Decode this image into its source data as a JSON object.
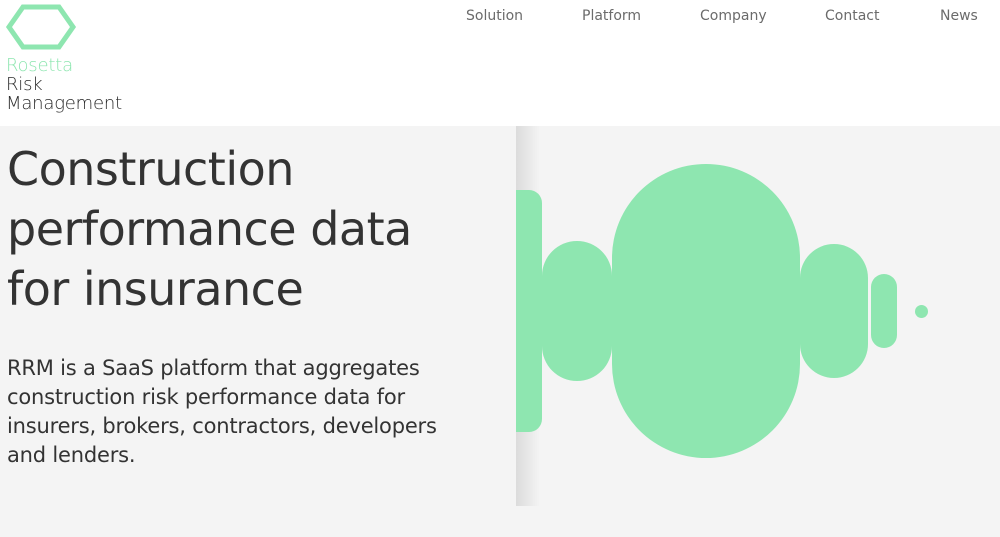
{
  "brand": {
    "name_line1": "Rosetta",
    "name_line2": "Risk",
    "name_line3": "Management",
    "accent_color": "#8ee6b0",
    "icon": "hexagon-logo-icon"
  },
  "nav": {
    "items": [
      {
        "label": "Solution"
      },
      {
        "label": "Platform"
      },
      {
        "label": "Company"
      },
      {
        "label": "Contact"
      },
      {
        "label": "News"
      }
    ]
  },
  "hero": {
    "title_line1": "Construction",
    "title_line2": "performance data",
    "title_line3": "for insurance",
    "description": "RRM is a SaaS platform that aggregates construction risk performance data for insurers, brokers, contractors, developers and lenders.",
    "background_color": "#f4f4f4",
    "graphic_color": "#8ee6b0"
  }
}
